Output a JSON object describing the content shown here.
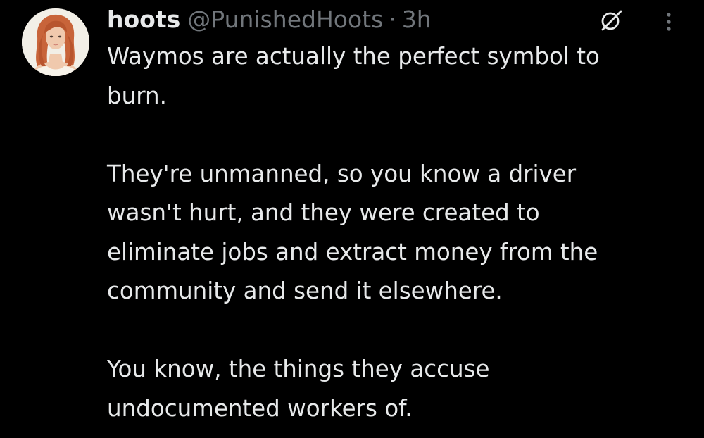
{
  "tweet": {
    "display_name": "hoots",
    "handle": "@PunishedHoots",
    "separator": "·",
    "time": "3h",
    "avatar_icon": "profile-photo",
    "grok_icon": "grok-icon",
    "more_icon": "more-vertical-icon",
    "paragraphs": [
      {
        "lines": [
          "Waymos are actually the perfect symbol to",
          "burn."
        ]
      },
      {
        "lines": [
          "They're unmanned, so you know a driver",
          "wasn't hurt, and they were created to",
          "eliminate jobs and extract money from the",
          "community and send it elsewhere."
        ]
      },
      {
        "lines": [
          "You know, the things they accuse",
          "undocumented workers of."
        ]
      }
    ]
  },
  "colors": {
    "background": "#000000",
    "text_primary": "#e7e9ea",
    "text_secondary": "#71767b",
    "avatar_hair": "#c8643a",
    "avatar_skin": "#f0c9ad",
    "avatar_background": "#f2efe7"
  }
}
